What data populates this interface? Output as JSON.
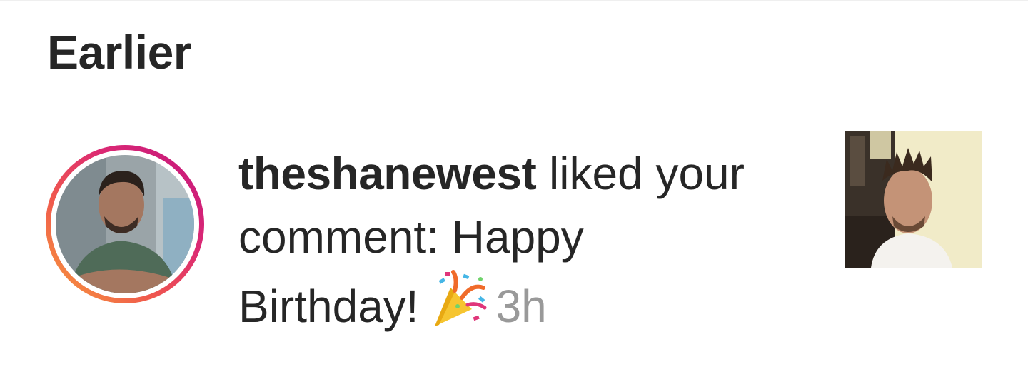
{
  "section": {
    "heading": "Earlier"
  },
  "notification": {
    "username": "theshanewest",
    "action_text": "liked your comment: Happy Birthday!",
    "emoji_icon": "party-popper-icon",
    "timestamp": "3h",
    "avatar_icon": "user-avatar-photo",
    "thumbnail_icon": "post-thumbnail-photo"
  },
  "colors": {
    "text": "#262626",
    "muted": "#999999",
    "story_ring_start": "#c1147e",
    "story_ring_end": "#f7a23a"
  }
}
